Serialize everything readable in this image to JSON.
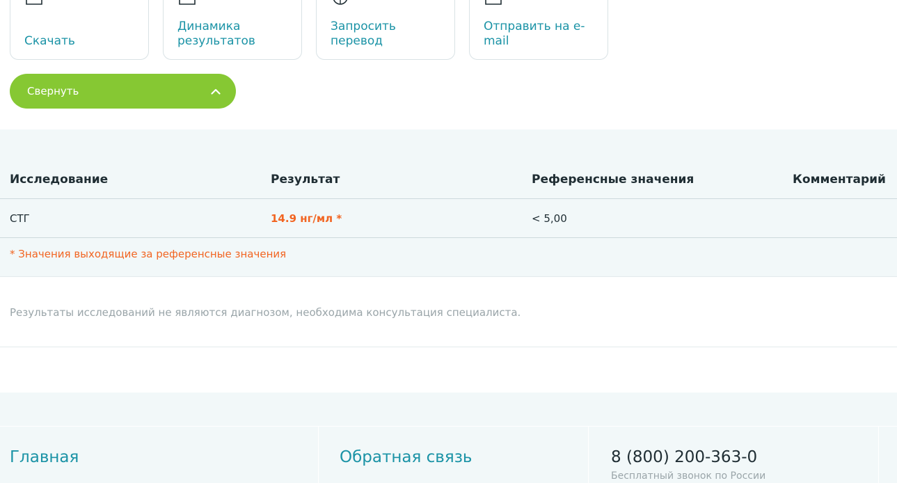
{
  "actions": {
    "download": "Скачать",
    "dynamics": "Динамика результатов",
    "translate": "Запросить перевод",
    "email": "Отправить на e-mail"
  },
  "collapse": {
    "label": "Свернуть"
  },
  "table": {
    "headers": {
      "study": "Исследование",
      "result": "Результат",
      "reference": "Референсные значения",
      "comment": "Комментарий"
    },
    "rows": [
      {
        "study": "СТГ",
        "result": "14.9 нг/мл *",
        "reference": "< 5,00",
        "comment": ""
      }
    ],
    "note": "* Значения выходящие за референсные значения"
  },
  "disclaimer": "Результаты исследований не являются диагнозом, необходима консультация специалиста.",
  "footer": {
    "home": "Главная",
    "feedback": "Обратная связь",
    "phone": "8 (800) 200-363-0",
    "phone_note": "Бесплатный звонок по России"
  },
  "colors": {
    "accent": "#1b93a6",
    "button": "#86c833",
    "flag": "#f26522"
  }
}
